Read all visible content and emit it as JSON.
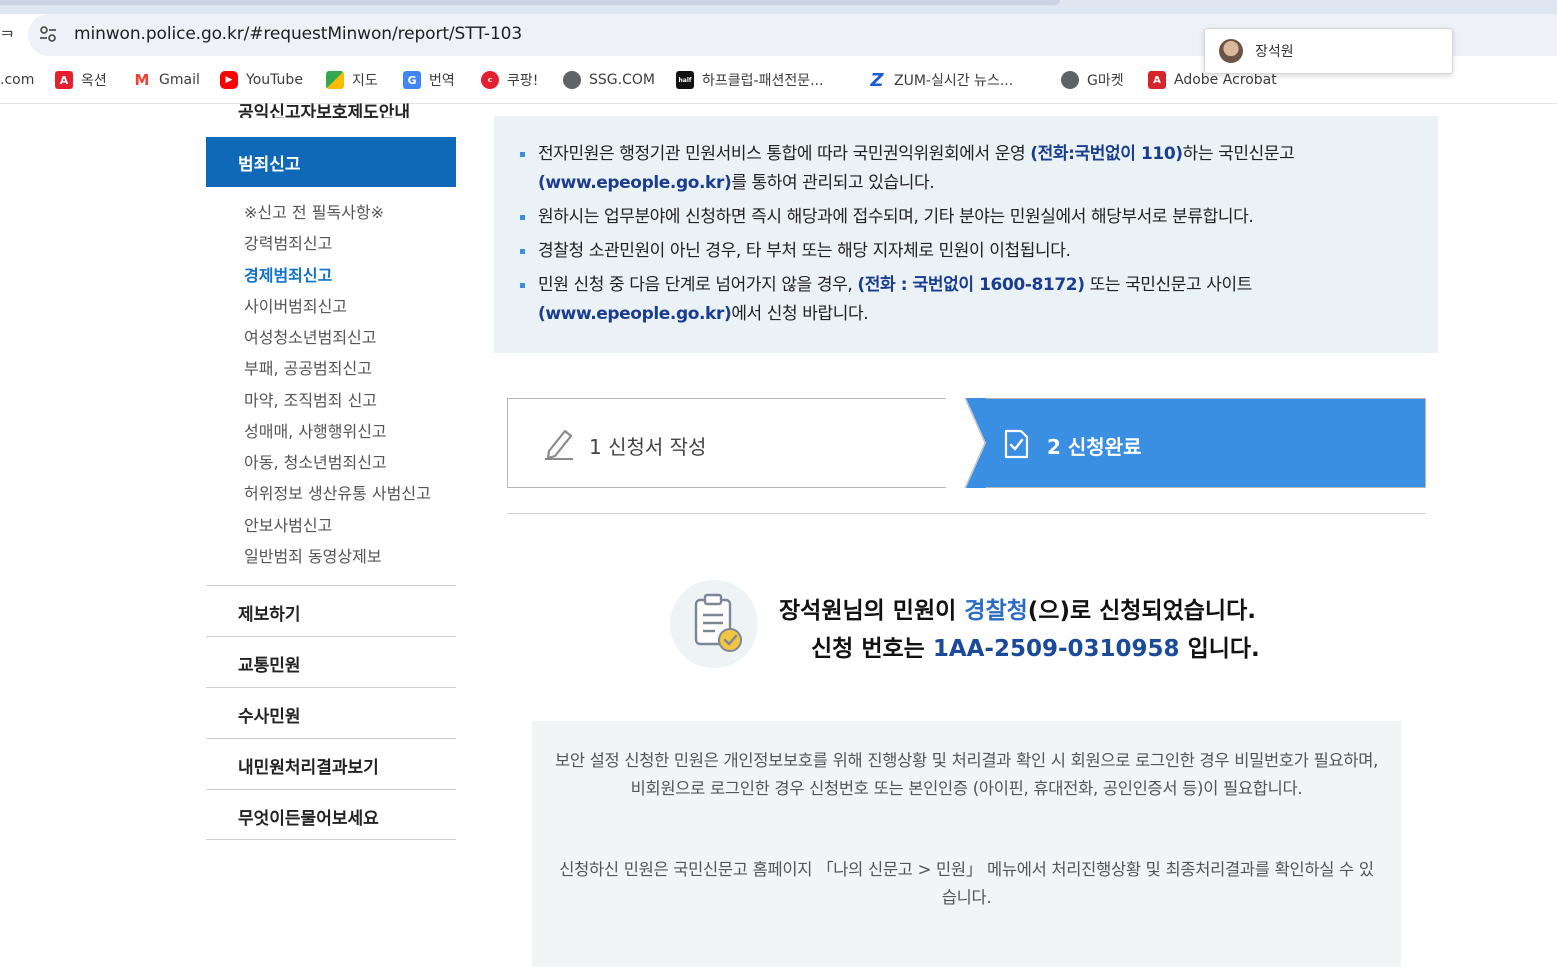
{
  "browser": {
    "url": "minwon.police.go.kr/#requestMinwon/report/STT-103",
    "cut_left_glyph": "ᄏ",
    "profile_name": "장석원",
    "bookmarks": [
      {
        "label": ".com",
        "icon": "globe-icon",
        "color": ""
      },
      {
        "label": "옥션",
        "icon": "auction-icon",
        "color": "#e4202e"
      },
      {
        "label": "Gmail",
        "icon": "gmail-icon",
        "color": "#ea4335"
      },
      {
        "label": "YouTube",
        "icon": "youtube-icon",
        "color": "#ff0000"
      },
      {
        "label": "지도",
        "icon": "maps-icon",
        "color": "#34a853"
      },
      {
        "label": "번역",
        "icon": "translate-icon",
        "color": "#4285f4"
      },
      {
        "label": "쿠팡!",
        "icon": "coupang-icon",
        "color": "#e4202e"
      },
      {
        "label": "SSG.COM",
        "icon": "globe-icon",
        "color": "#5f6368"
      },
      {
        "label": "하프클럽-패션전문...",
        "icon": "halfclub-icon",
        "color": "#111111"
      },
      {
        "label": "ZUM-실시간 뉴스...",
        "icon": "zum-icon",
        "color": "#1a5bd6"
      },
      {
        "label": "G마켓",
        "icon": "globe-icon",
        "color": "#5f6368"
      },
      {
        "label": "Adobe Acrobat",
        "icon": "acrobat-icon",
        "color": "#d7262b"
      }
    ]
  },
  "sidebar": {
    "top_cut_label": "공익신고자보호제도안내",
    "active_label": "범죄신고",
    "subitems": [
      "※신고 전 필독사항※",
      "강력범죄신고",
      "경제범죄신고",
      "사이버범죄신고",
      "여성청소년범죄신고",
      "부패, 공공범죄신고",
      "마약, 조직범죄 신고",
      "성매매, 사행행위신고",
      "아동, 청소년범죄신고",
      "허위정보 생산유통 사범신고",
      "안보사범신고",
      "일반범죄 동영상제보"
    ],
    "current_subitem": "경제범죄신고",
    "sections": [
      "제보하기",
      "교통민원",
      "수사민원",
      "내민원처리결과보기",
      "무엇이든물어보세요"
    ]
  },
  "notice": {
    "item1_a": "전자민원은 행정기관 민원서비스 통합에 따라 국민권익위원회에서 운영 ",
    "item1_hl1": "(전화:국번없이 110)",
    "item1_b": "하는 국민신문고 ",
    "item1_hl2": "(www.epeople.go.kr)",
    "item1_c": "를 통하여 관리되고 있습니다.",
    "item2": "원하시는 업무분야에 신청하면 즉시 해당과에 접수되며, 기타 분야는 민원실에서 해당부서로 분류합니다.",
    "item3": "경찰청 소관민원이 아닌 경우, 타 부처 또는 해당 지자체로 민원이 이첩됩니다.",
    "item4_a": "민원 신청 중 다음 단계로 넘어가지 않을 경우, ",
    "item4_hl1": "(전화 : 국번없이 1600-8172)",
    "item4_b": " 또는 국민신문고 사이트 ",
    "item4_hl2": "(www.epeople.go.kr)",
    "item4_c": "에서 신청 바랍니다."
  },
  "steps": {
    "step1": "1 신청서 작성",
    "step2": "2 신청완료"
  },
  "completion": {
    "name_part": "장석원님의 민원이 ",
    "agency": "경찰청",
    "suffix": "(으)로 신청되었습니다.",
    "number_prefix": "신청 번호는 ",
    "number": "1AA-2509-0310958",
    "number_suffix": " 입니다."
  },
  "info": {
    "para1": "보안 설정 신청한 민원은 개인정보보호를 위해 진행상황 및 처리결과 확인 시 회원으로 로그인한 경우 비밀번호가 필요하며, 비회원으로 로그인한 경우 신청번호 또는 본인인증 (아이핀, 휴대전화, 공인인증서 등)이 필요합니다.",
    "para2": "신청하신 민원은 국민신문고 홈페이지 「나의 신문고 > 민원」 메뉴에서 처리진행상황 및 최종처리결과를 확인하실 수 있습니다."
  }
}
